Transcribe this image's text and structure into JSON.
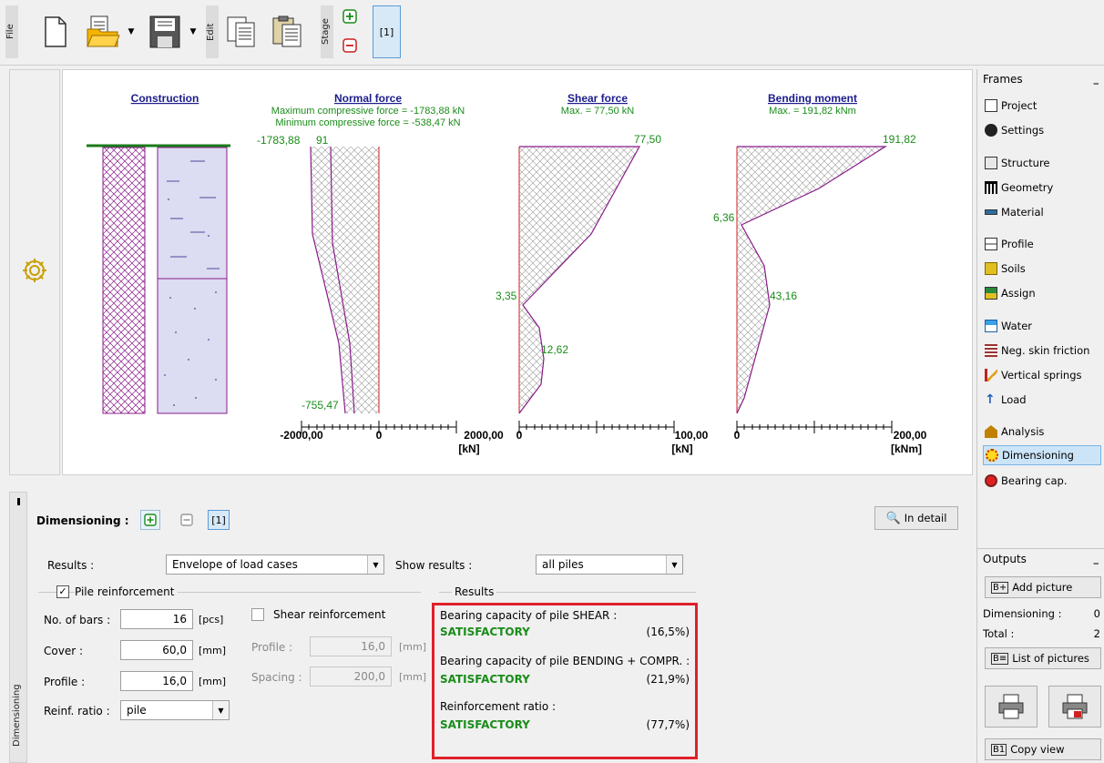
{
  "toolbar": {
    "file_label": "File",
    "edit_label": "Edit",
    "stage_label": "Stage",
    "stage_tab": "[1]"
  },
  "left": {
    "bottom_tab": "Dimensioning"
  },
  "diagram": {
    "construction": {
      "title": "Construction"
    },
    "normal": {
      "title": "Normal force",
      "line1": "Maximum compressive force = -1783,88 kN",
      "line2": "Minimum compressive force = -538,47 kN",
      "top_label": "-1783,88",
      "top_label2": "91",
      "bottom_label": "-755,47",
      "axis_left": "-2000,00",
      "axis_zero": "0",
      "axis_right": "2000,00",
      "unit": "[kN]"
    },
    "shear": {
      "title": "Shear force",
      "line1": "Max. = 77,50 kN",
      "top_value": "77,50",
      "mid_value": "3,35",
      "low_value": "12,62",
      "axis_zero": "0",
      "axis_right": "100,00",
      "unit": "[kN]"
    },
    "moment": {
      "title": "Bending moment",
      "line1": "Max. = 191,82 kNm",
      "top_value": "191,82",
      "mid_value": "6,36",
      "low_value": "43,16",
      "axis_zero": "0",
      "axis_right": "200,00",
      "unit": "[kNm]"
    }
  },
  "frames": {
    "header": "Frames",
    "items": [
      {
        "label": "Project"
      },
      {
        "label": "Settings"
      },
      {
        "label": "Structure"
      },
      {
        "label": "Geometry"
      },
      {
        "label": "Material"
      },
      {
        "label": "Profile"
      },
      {
        "label": "Soils"
      },
      {
        "label": "Assign"
      },
      {
        "label": "Water"
      },
      {
        "label": "Neg. skin friction"
      },
      {
        "label": "Vertical springs"
      },
      {
        "label": "Load"
      },
      {
        "label": "Analysis"
      },
      {
        "label": "Dimensioning"
      },
      {
        "label": "Bearing cap."
      }
    ]
  },
  "outputs": {
    "header": "Outputs",
    "add_picture": "Add picture",
    "dim_label": "Dimensioning :",
    "dim_count": "0",
    "total_label": "Total :",
    "total_count": "2",
    "list_pictures": "List of pictures",
    "copy_view": "Copy view"
  },
  "bottom": {
    "dim_label": "Dimensioning :",
    "dim_tab": "[1]",
    "in_detail": "In detail",
    "results_label": "Results :",
    "results_value": "Envelope of load cases",
    "show_results_label": "Show results :",
    "show_results_value": "all piles",
    "pile_reinf": "Pile reinforcement",
    "bars_label": "No. of bars :",
    "bars_value": "16",
    "bars_unit": "[pcs]",
    "cover_label": "Cover :",
    "cover_value": "60,0",
    "cover_unit": "[mm]",
    "profile_label": "Profile :",
    "profile_value": "16,0",
    "profile_unit": "[mm]",
    "ratio_label": "Reinf. ratio :",
    "ratio_value": "pile",
    "shear_reinf": "Shear reinforcement",
    "sh_profile_label": "Profile :",
    "sh_profile_value": "16,0",
    "sh_profile_unit": "[mm]",
    "sh_spacing_label": "Spacing :",
    "sh_spacing_value": "200,0",
    "sh_spacing_unit": "[mm]",
    "results_group": "Results",
    "r1_label": "Bearing capacity of pile SHEAR :",
    "r1_status": "SATISFACTORY",
    "r1_pct": "(16,5%)",
    "r2_label": "Bearing capacity of pile BENDING + COMPR. :",
    "r2_status": "SATISFACTORY",
    "r2_pct": "(21,9%)",
    "r3_label": "Reinforcement ratio :",
    "r3_status": "SATISFACTORY",
    "r3_pct": "(77,7%)"
  },
  "colors": {
    "curve": "#8a1c8a",
    "value": "#1a8c1a",
    "title": "#1c1c8c",
    "highlight": "#e0202a"
  }
}
